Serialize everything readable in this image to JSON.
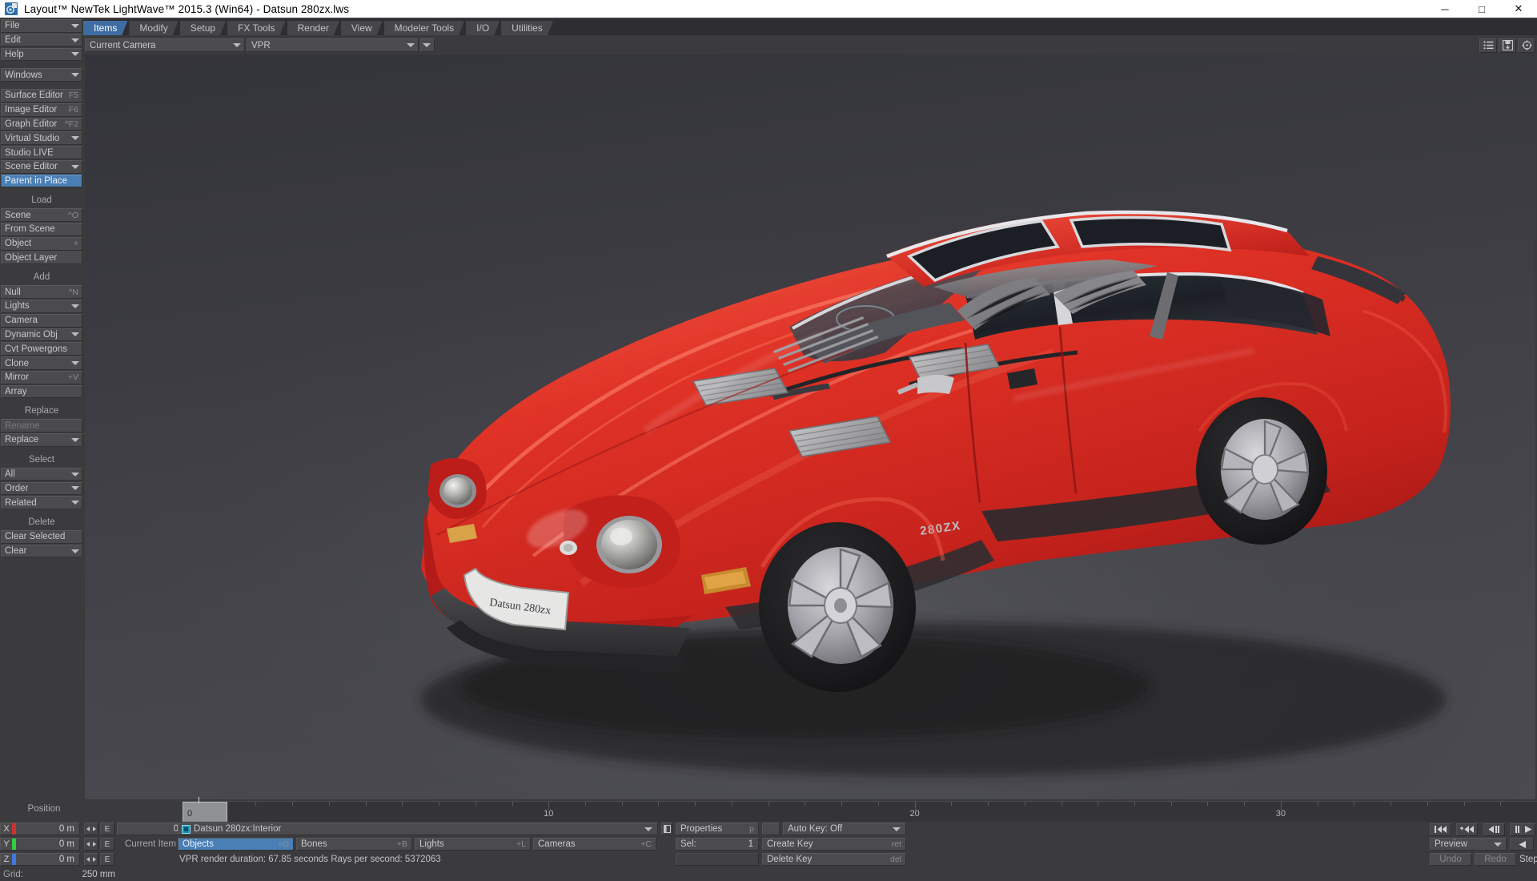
{
  "window": {
    "title": "Layout™ NewTek LightWave™ 2015.3 (Win64) - Datsun 280zx.lws",
    "app_icon": "lightwave-logo-icon",
    "buttons": [
      {
        "name": "minimize",
        "glyph": "─"
      },
      {
        "name": "maximize",
        "glyph": "□"
      },
      {
        "name": "close",
        "glyph": "✕"
      }
    ]
  },
  "menu_tabs": [
    {
      "label": "Items",
      "active": true
    },
    {
      "label": "Modify",
      "active": false
    },
    {
      "label": "Setup",
      "active": false
    },
    {
      "label": "FX Tools",
      "active": false
    },
    {
      "label": "Render",
      "active": false
    },
    {
      "label": "View",
      "active": false
    },
    {
      "label": "Modeler Tools",
      "active": false
    },
    {
      "label": "I/O",
      "active": false
    },
    {
      "label": "Utilities",
      "active": false
    }
  ],
  "sidebar": {
    "top_menus": [
      {
        "label": "File",
        "arrow": true,
        "key": ""
      },
      {
        "label": "Edit",
        "arrow": true,
        "key": ""
      },
      {
        "label": "Help",
        "arrow": true,
        "key": ""
      }
    ],
    "windows_menu": {
      "label": "Windows",
      "arrow": true
    },
    "editors": [
      {
        "label": "Surface Editor",
        "key": "F5",
        "arrow": false
      },
      {
        "label": "Image Editor",
        "key": "F6",
        "arrow": false
      },
      {
        "label": "Graph Editor",
        "key": "^F2",
        "arrow": false
      },
      {
        "label": "Virtual Studio",
        "key": "",
        "arrow": true
      },
      {
        "label": "Studio LIVE",
        "key": "",
        "arrow": false
      },
      {
        "label": "Scene Editor",
        "key": "",
        "arrow": true
      }
    ],
    "parent_in_place": {
      "label": "Parent in Place",
      "selected": true
    },
    "groups": [
      {
        "header": "Load",
        "items": [
          {
            "label": "Scene",
            "key": "^O",
            "arrow": false
          },
          {
            "label": "From Scene",
            "key": "",
            "arrow": false
          },
          {
            "label": "Object",
            "key": "+",
            "arrow": false
          },
          {
            "label": "Object Layer",
            "key": "",
            "arrow": false
          }
        ]
      },
      {
        "header": "Add",
        "items": [
          {
            "label": "Null",
            "key": "^N",
            "arrow": false
          },
          {
            "label": "Lights",
            "key": "",
            "arrow": true
          },
          {
            "label": "Camera",
            "key": "",
            "arrow": false
          },
          {
            "label": "Dynamic Obj",
            "key": "",
            "arrow": true
          },
          {
            "label": "Cvt Powergons",
            "key": "",
            "arrow": false
          },
          {
            "label": "Clone",
            "key": "",
            "arrow": true
          },
          {
            "label": "Mirror",
            "key": "+V",
            "arrow": false
          },
          {
            "label": "Array",
            "key": "",
            "arrow": false
          }
        ]
      },
      {
        "header": "Replace",
        "items": [
          {
            "label": "Rename",
            "key": "",
            "arrow": false,
            "dim": true
          },
          {
            "label": "Replace",
            "key": "",
            "arrow": true
          }
        ]
      },
      {
        "header": "Select",
        "items": [
          {
            "label": "All",
            "key": "",
            "arrow": true
          },
          {
            "label": "Order",
            "key": "",
            "arrow": true
          },
          {
            "label": "Related",
            "key": "",
            "arrow": true
          }
        ]
      },
      {
        "header": "Delete",
        "items": [
          {
            "label": "Clear Selected",
            "key": "",
            "arrow": false
          },
          {
            "label": "Clear",
            "key": "",
            "arrow": true
          }
        ]
      }
    ]
  },
  "viewport_bar": {
    "camera_select": "Current Camera",
    "render_mode": "VPR",
    "icons": [
      "list-icon",
      "save-disk-icon",
      "crosshair-target-icon"
    ]
  },
  "timeline": {
    "current_frame": "0",
    "labels": [
      "10",
      "20",
      "30"
    ],
    "label_frames": [
      10,
      20,
      30
    ],
    "range_start": 0,
    "range_end": 37
  },
  "transform_panel": {
    "title": "Position",
    "rows": [
      {
        "axis": "X",
        "value": "0 m",
        "color": "#cc3333",
        "expand": "E"
      },
      {
        "axis": "Y",
        "value": "0 m",
        "color": "#33cc44",
        "expand": "E"
      },
      {
        "axis": "Z",
        "value": "0 m",
        "color": "#4477dd",
        "expand": "E"
      }
    ],
    "grid_label": "Grid:",
    "grid_value": "250 mm"
  },
  "item_panel": {
    "frame_field": "0",
    "current_item_label": "Current Item",
    "current_item_value": "Datsun 280zx:Interior",
    "current_item_icon": "object-cube-icon",
    "item_dropdown_icon": "chevron-down-icon",
    "item_props_icon": "panel-icon",
    "mode_buttons": [
      {
        "label": "Objects",
        "key": "+O",
        "selected": true
      },
      {
        "label": "Bones",
        "key": "+B",
        "selected": false
      },
      {
        "label": "Lights",
        "key": "+L",
        "selected": false
      },
      {
        "label": "Cameras",
        "key": "+C",
        "selected": false
      }
    ],
    "status_text": "VPR render duration: 67.85 seconds  Rays per second: 5372063"
  },
  "key_panel": {
    "properties_label": "Properties",
    "properties_key": "p",
    "sel_label": "Sel:",
    "sel_value": "1",
    "autokey_label": "Auto Key: Off",
    "create_key_label": "Create Key",
    "create_key_key": "ret",
    "delete_key_label": "Delete Key",
    "delete_key_key": "del"
  },
  "playback": {
    "buttons": [
      {
        "name": "go-to-start-button",
        "glyph": "skip-start-icon"
      },
      {
        "name": "prev-key-button",
        "glyph": "prev-key-icon"
      },
      {
        "name": "step-back-button",
        "glyph": "step-back-icon"
      },
      {
        "name": "step-forward-button",
        "glyph": "step-forward-icon"
      },
      {
        "name": "play-forward-button",
        "glyph": "play-icon"
      }
    ],
    "preview_label": "Preview",
    "play-back": "play-reverse-icon",
    "undo_label": "Undo",
    "redo_label": "Redo",
    "step_label": "Step"
  },
  "scene": {
    "object_name": "Datsun 280zx",
    "badge_text": "280ZX",
    "plate_text": "Datsun 280zx",
    "body_color": "#cf2020",
    "body_color_dark": "#8e1212",
    "body_color_light": "#e84a3a",
    "background_top": "#3a3a3e",
    "background_bottom": "#46464a",
    "glass_color": "#2a2d33",
    "trim_color": "#d8d8dc",
    "tire_color": "#1d1d1f",
    "rim_color": "#a8a8ac"
  }
}
